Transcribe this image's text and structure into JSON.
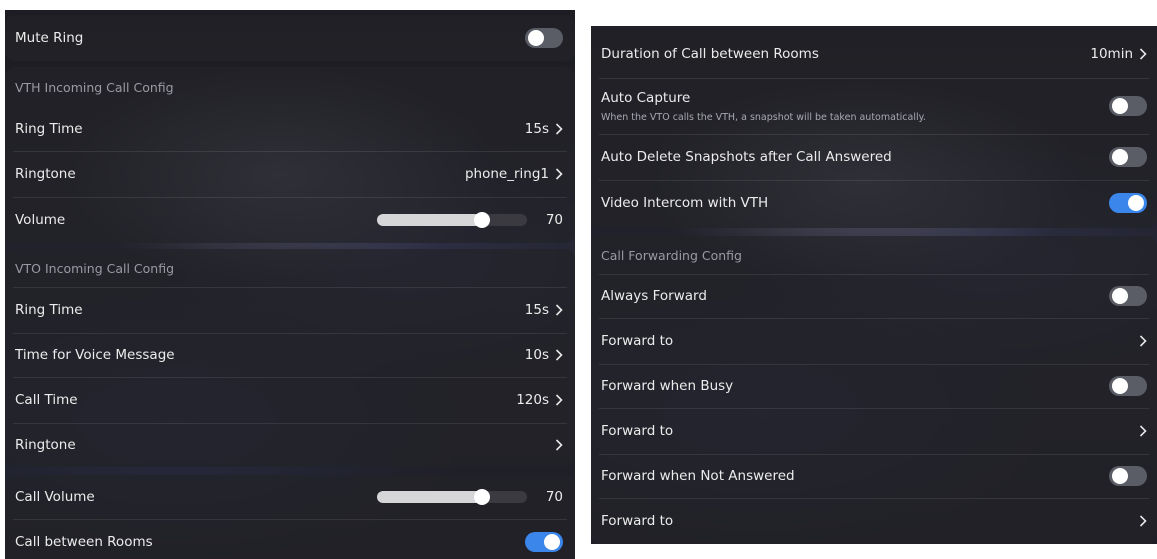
{
  "left": {
    "mute_ring": {
      "label": "Mute Ring",
      "enabled": false
    },
    "vth": {
      "title": "VTH Incoming Call Config",
      "ring_time": {
        "label": "Ring Time",
        "value": "15s"
      },
      "ringtone": {
        "label": "Ringtone",
        "value": "phone_ring1"
      },
      "volume": {
        "label": "Volume",
        "value": "70",
        "level": 0.7
      }
    },
    "vto": {
      "title": "VTO Incoming Call Config",
      "ring_time": {
        "label": "Ring Time",
        "value": "15s"
      },
      "voice_message": {
        "label": "Time for Voice Message",
        "value": "10s"
      },
      "call_time": {
        "label": "Call Time",
        "value": "120s"
      },
      "ringtone": {
        "label": "Ringtone",
        "value": ""
      }
    },
    "call_volume": {
      "label": "Call Volume",
      "value": "70",
      "level": 0.7
    },
    "call_between_rooms": {
      "label": "Call between Rooms",
      "enabled": true
    }
  },
  "right": {
    "duration": {
      "label": "Duration of Call between Rooms",
      "value": "10min"
    },
    "auto_capture": {
      "label": "Auto Capture",
      "description": "When the VTO calls the VTH, a snapshot will be taken automatically.",
      "enabled": false
    },
    "auto_delete": {
      "label": "Auto Delete Snapshots after Call Answered",
      "enabled": false
    },
    "video_intercom": {
      "label": "Video Intercom with VTH",
      "enabled": true
    },
    "forwarding": {
      "title": "Call Forwarding Config",
      "always_forward": {
        "label": "Always Forward",
        "enabled": false
      },
      "forward_to_1": {
        "label": "Forward to"
      },
      "when_busy": {
        "label": "Forward when Busy",
        "enabled": false
      },
      "forward_to_2": {
        "label": "Forward to"
      },
      "when_not_answered": {
        "label": "Forward when Not Answered",
        "enabled": false
      },
      "forward_to_3": {
        "label": "Forward to"
      }
    }
  },
  "colors": {
    "toggle_on": "#3a86ea",
    "toggle_off": "#5a5d66",
    "slider_fill": "#d6d6d8"
  }
}
